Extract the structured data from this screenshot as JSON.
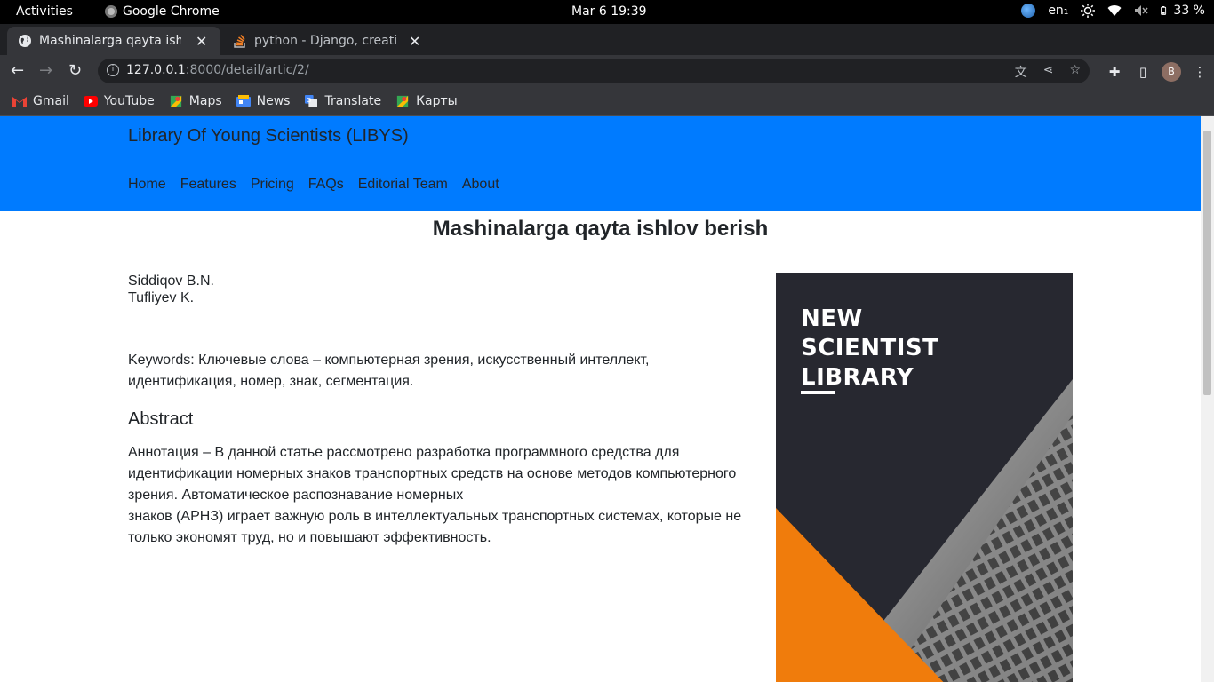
{
  "system_bar": {
    "activities": "Activities",
    "app_name": "Google Chrome",
    "clock": "Mar 6  19:39",
    "keyboard_layout": "en₁",
    "battery": "33 %"
  },
  "tabs": [
    {
      "title": "Mashinalarga qayta ishlov berish",
      "active": true
    },
    {
      "title": "python - Django, creating",
      "active": false
    }
  ],
  "toolbar": {
    "url_host": "127.0.0.1",
    "url_path": ":8000/detail/artic/2/",
    "avatar_letter": "B"
  },
  "bookmarks": [
    {
      "label": "Gmail",
      "icon": "gmail-icon"
    },
    {
      "label": "YouTube",
      "icon": "youtube-icon"
    },
    {
      "label": "Maps",
      "icon": "maps-icon"
    },
    {
      "label": "News",
      "icon": "news-icon"
    },
    {
      "label": "Translate",
      "icon": "translate-icon"
    },
    {
      "label": "Карты",
      "icon": "maps-icon"
    }
  ],
  "site": {
    "brand": "Library Of Young Scientists (LIBYS)",
    "nav": [
      "Home",
      "Features",
      "Pricing",
      "FAQs",
      "Editorial Team",
      "About"
    ],
    "colors": {
      "header": "#007bff",
      "cover_dark": "#272830",
      "cover_orange": "#f07c0c"
    }
  },
  "article": {
    "title": "Mashinalarga qayta ishlov berish",
    "authors": [
      "Siddiqov B.N.",
      "Tufliyev K."
    ],
    "keywords": "Keywords: Ключевые слова – компьютерная зрения, искусственный интеллект, идентификация, номер, знак, сегментация.",
    "abstract_heading": "Abstract",
    "abstract_line1": "Аннотация – В данной статье рассмотрено разработка программного средства для идентификации номерных знаков транспортных средств на основе методов компьютерного зрения. Автоматическое распознавание номерных",
    "abstract_line2": "знаков (АРНЗ) играет важную роль в интеллектуальных транспортных системах, которые не только экономят труд, но и повышают эффективность.",
    "cover": {
      "line1": "NEW",
      "line2": "SCIENTIST",
      "line3": "LIBRARY"
    }
  }
}
